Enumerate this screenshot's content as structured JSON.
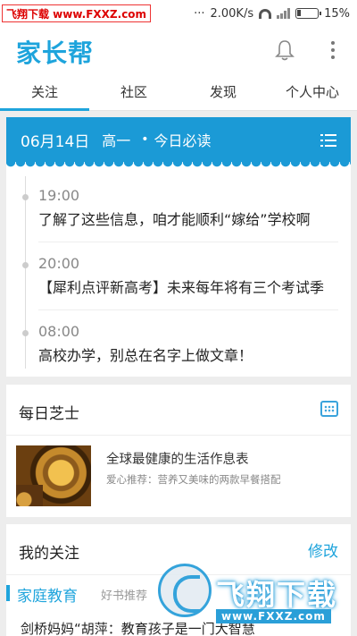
{
  "statusbar": {
    "watermark": "飞翔下载 www.FXXZ.com",
    "speed": "2.00K/s",
    "battery": "15%"
  },
  "app": {
    "logo": "家长帮"
  },
  "tabs": [
    "关注",
    "社区",
    "发现",
    "个人中心"
  ],
  "today": {
    "date": "06月14日",
    "grade": "高一",
    "bullet": "•",
    "title": "今日必读",
    "items": [
      {
        "time": "19:00",
        "text": "了解了这些信息，咱才能顺利“嫁给”学校啊"
      },
      {
        "time": "20:00",
        "text": "【犀利点评新高考】未来每年将有三个考试季"
      },
      {
        "time": "08:00",
        "text": "高校办学，别总在名字上做文章！"
      }
    ]
  },
  "daily": {
    "title": "每日芝士",
    "article_title": "全球最健康的生活作息表",
    "article_sub": "爱心推荐：营养又美味的两款早餐搭配"
  },
  "follow": {
    "title": "我的关注",
    "edit": "修改",
    "category": "家庭教育",
    "category_sub": "好书推荐",
    "article": "剑桥妈妈“胡萍：教育孩子是一门大智慧"
  },
  "watermark": {
    "text": "飞翔下载",
    "url": "www.FXXZ.com"
  },
  "colors": {
    "accent": "#1ea4dc",
    "header_bg": "#1b9ad6"
  }
}
